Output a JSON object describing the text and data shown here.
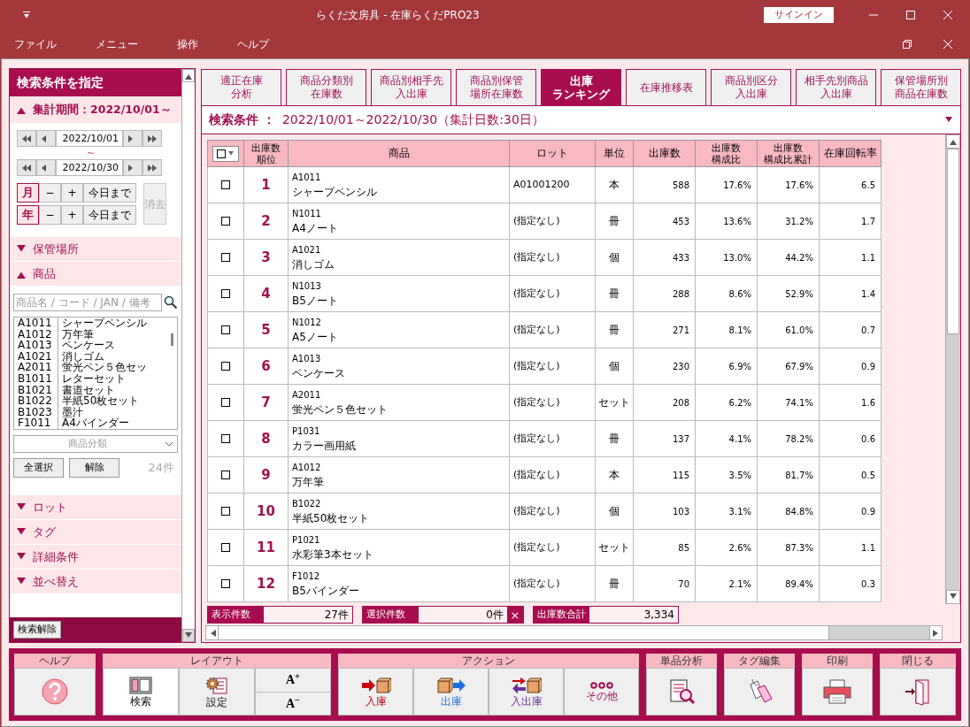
{
  "window": {
    "title": "らくだ文房具  -  在庫らくだPRO23",
    "signin": "サインイン"
  },
  "menu": [
    "ファイル",
    "メニュー",
    "操作",
    "ヘルプ"
  ],
  "sidebar": {
    "title": "検索条件を指定",
    "period": {
      "label": "集計期間：2022/10/01～",
      "expanded": true,
      "date_from": "2022/10/01",
      "tilde": "～",
      "date_to": "2022/10/30",
      "steps": [
        {
          "unit": "月",
          "minus": "−",
          "plus": "+",
          "today": "今日まで"
        },
        {
          "unit": "年",
          "minus": "−",
          "plus": "+",
          "today": "今日まで"
        }
      ],
      "clear": {
        "label": "消去",
        "disabled": true
      }
    },
    "sections_before": [
      {
        "label": "保管場所",
        "expanded": false
      }
    ],
    "product": {
      "label": "商品",
      "expanded": true,
      "placeholder": "商品名 / コード / JAN / 備考",
      "items": [
        {
          "code": "A1011",
          "name": "シャープペンシル"
        },
        {
          "code": "A1012",
          "name": "万年筆"
        },
        {
          "code": "A1013",
          "name": "ペンケース"
        },
        {
          "code": "A1021",
          "name": "消しゴム"
        },
        {
          "code": "A2011",
          "name": "蛍光ペン５色セッ"
        },
        {
          "code": "B1011",
          "name": "レターセット"
        },
        {
          "code": "B1021",
          "name": "書道セット"
        },
        {
          "code": "B1022",
          "name": "半紙50枚セット"
        },
        {
          "code": "B1023",
          "name": "墨汁"
        },
        {
          "code": "F1011",
          "name": "A4バインダー"
        }
      ],
      "category_placeholder": "商品分類",
      "select_all": "全選択",
      "deselect": "解除",
      "count": "24件"
    },
    "sections_after": [
      {
        "label": "ロット",
        "expanded": false
      },
      {
        "label": "タグ",
        "expanded": false
      },
      {
        "label": "詳細条件",
        "expanded": false
      },
      {
        "label": "並べ替え",
        "expanded": false
      }
    ],
    "reset": "検索解除"
  },
  "tabs": [
    {
      "lines": [
        "適正在庫",
        "分析"
      ],
      "selected": false
    },
    {
      "lines": [
        "商品分類別",
        "在庫数"
      ],
      "selected": false
    },
    {
      "lines": [
        "商品別相手先",
        "入出庫"
      ],
      "selected": false
    },
    {
      "lines": [
        "商品別保管",
        "場所在庫数"
      ],
      "selected": false
    },
    {
      "lines": [
        "出庫",
        "ランキング"
      ],
      "selected": true
    },
    {
      "lines": [
        "在庫推移表"
      ],
      "selected": false
    },
    {
      "lines": [
        "商品別区分",
        "入出庫"
      ],
      "selected": false
    },
    {
      "lines": [
        "相手先別商品",
        "入出庫"
      ],
      "selected": false
    },
    {
      "lines": [
        "保管場所別",
        "商品在庫数"
      ],
      "selected": false
    }
  ],
  "condition": {
    "label": "検索条件 ：",
    "value": "2022/10/01～2022/10/30（集計日数:30日）"
  },
  "table": {
    "all_checked": false,
    "columns": [
      {
        "lines": [
          "出庫数",
          "順位"
        ]
      },
      {
        "lines": [
          "商品"
        ]
      },
      {
        "lines": [
          "ロット"
        ]
      },
      {
        "lines": [
          "単位"
        ]
      },
      {
        "lines": [
          "出庫数"
        ]
      },
      {
        "lines": [
          "出庫数",
          "構成比"
        ]
      },
      {
        "lines": [
          "出庫数",
          "構成比累計"
        ]
      },
      {
        "lines": [
          "在庫回転率"
        ]
      }
    ],
    "rows": [
      {
        "checked": false,
        "rank": "1",
        "code": "A1011",
        "name": "シャープペンシル",
        "lot": "A01001200",
        "unit": "本",
        "qty": "588",
        "ratio": "17.6%",
        "cumulative": "17.6%",
        "turnover": "6.5"
      },
      {
        "checked": false,
        "rank": "2",
        "code": "N1011",
        "name": "A4ノート",
        "lot": "(指定なし)",
        "unit": "冊",
        "qty": "453",
        "ratio": "13.6%",
        "cumulative": "31.2%",
        "turnover": "1.7"
      },
      {
        "checked": false,
        "rank": "3",
        "code": "A1021",
        "name": "消しゴム",
        "lot": "(指定なし)",
        "unit": "個",
        "qty": "433",
        "ratio": "13.0%",
        "cumulative": "44.2%",
        "turnover": "1.1"
      },
      {
        "checked": false,
        "rank": "4",
        "code": "N1013",
        "name": "B5ノート",
        "lot": "(指定なし)",
        "unit": "冊",
        "qty": "288",
        "ratio": "8.6%",
        "cumulative": "52.9%",
        "turnover": "1.4"
      },
      {
        "checked": false,
        "rank": "5",
        "code": "N1012",
        "name": "A5ノート",
        "lot": "(指定なし)",
        "unit": "冊",
        "qty": "271",
        "ratio": "8.1%",
        "cumulative": "61.0%",
        "turnover": "0.7"
      },
      {
        "checked": false,
        "rank": "6",
        "code": "A1013",
        "name": "ペンケース",
        "lot": "(指定なし)",
        "unit": "個",
        "qty": "230",
        "ratio": "6.9%",
        "cumulative": "67.9%",
        "turnover": "0.9"
      },
      {
        "checked": false,
        "rank": "7",
        "code": "A2011",
        "name": "蛍光ペン５色セット",
        "lot": "(指定なし)",
        "unit": "セット",
        "qty": "208",
        "ratio": "6.2%",
        "cumulative": "74.1%",
        "turnover": "1.6"
      },
      {
        "checked": false,
        "rank": "8",
        "code": "P1031",
        "name": "カラー画用紙",
        "lot": "(指定なし)",
        "unit": "冊",
        "qty": "137",
        "ratio": "4.1%",
        "cumulative": "78.2%",
        "turnover": "0.6"
      },
      {
        "checked": false,
        "rank": "9",
        "code": "A1012",
        "name": "万年筆",
        "lot": "(指定なし)",
        "unit": "本",
        "qty": "115",
        "ratio": "3.5%",
        "cumulative": "81.7%",
        "turnover": "0.5"
      },
      {
        "checked": false,
        "rank": "10",
        "code": "B1022",
        "name": "半紙50枚セット",
        "lot": "(指定なし)",
        "unit": "個",
        "qty": "103",
        "ratio": "3.1%",
        "cumulative": "84.8%",
        "turnover": "0.9"
      },
      {
        "checked": false,
        "rank": "11",
        "code": "P1021",
        "name": "水彩筆3本セット",
        "lot": "(指定なし)",
        "unit": "セット",
        "qty": "85",
        "ratio": "2.6%",
        "cumulative": "87.3%",
        "turnover": "1.1"
      },
      {
        "checked": false,
        "rank": "12",
        "code": "F1012",
        "name": "B5バインダー",
        "lot": "(指定なし)",
        "unit": "冊",
        "qty": "70",
        "ratio": "2.1%",
        "cumulative": "89.4%",
        "turnover": "0.3"
      }
    ]
  },
  "summary": [
    {
      "label": "表示件数",
      "value": "27件"
    },
    {
      "label": "選択件数",
      "value": "0件",
      "clear": "×"
    },
    {
      "label": "出庫数合計",
      "value": "3,334"
    }
  ],
  "toolbar": [
    {
      "title": "ヘルプ",
      "buttons": [
        {
          "kind": "help"
        }
      ]
    },
    {
      "title": "レイアウト",
      "buttons": [
        {
          "kind": "search-layout",
          "label": "検索",
          "selected": true
        },
        {
          "kind": "settings",
          "label": "設定",
          "selected": false
        },
        {
          "kind": "font",
          "up": "A$^{+}$",
          "down": "A$^{−}$"
        }
      ]
    },
    {
      "title": "アクション",
      "buttons": [
        {
          "kind": "in",
          "label": "入庫",
          "color": "#c8000f"
        },
        {
          "kind": "out",
          "label": "出庫",
          "color": "#1a6fe0"
        },
        {
          "kind": "inout",
          "label": "入出庫",
          "color": "#6b2fa0"
        },
        {
          "kind": "other",
          "label": "その他",
          "color": "#a0104f"
        }
      ]
    },
    {
      "title": "単品分析",
      "buttons": [
        {
          "kind": "analysis"
        }
      ]
    },
    {
      "title": "タグ編集",
      "buttons": [
        {
          "kind": "tag"
        }
      ]
    },
    {
      "title": "印刷",
      "buttons": [
        {
          "kind": "print"
        }
      ]
    },
    {
      "title": "閉じる",
      "buttons": [
        {
          "kind": "exit"
        }
      ]
    }
  ]
}
